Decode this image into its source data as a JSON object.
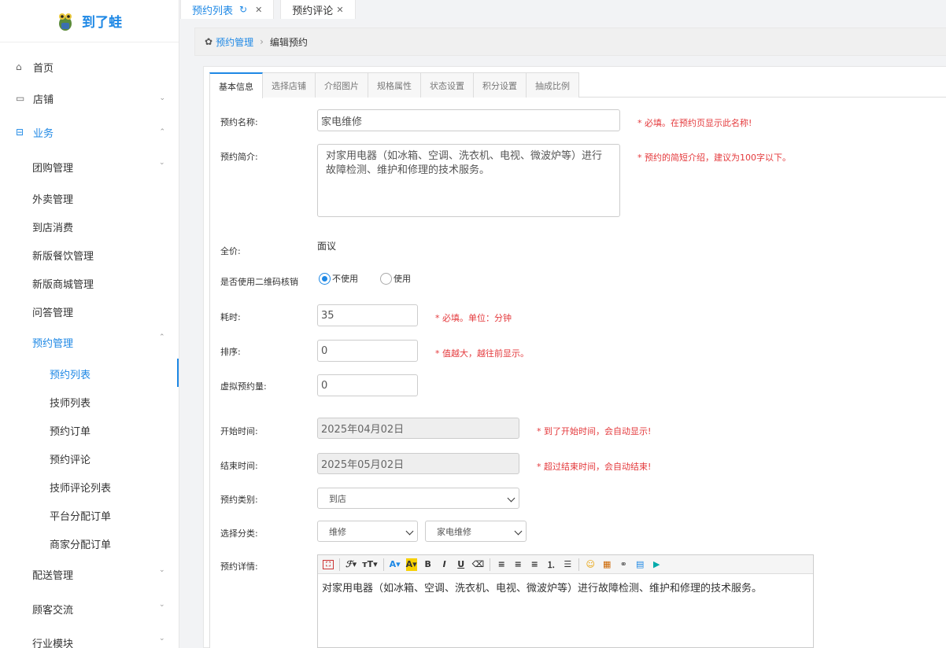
{
  "app": {
    "title": "到了蛙"
  },
  "sidebar": {
    "items": [
      {
        "label": "首页",
        "icon": "home-icon"
      },
      {
        "label": "店铺",
        "icon": "store-icon"
      },
      {
        "label": "业务",
        "icon": "business-icon"
      }
    ],
    "business_subs": [
      "团购管理",
      "外卖管理",
      "到店消费",
      "新版餐饮管理",
      "新版商城管理",
      "问答管理",
      "预约管理"
    ],
    "booking_subs": [
      "预约列表",
      "技师列表",
      "预约订单",
      "预约评论",
      "技师评论列表",
      "平台分配订单",
      "商家分配订单"
    ],
    "more": [
      "配送管理",
      "顾客交流",
      "行业模块"
    ]
  },
  "tabs": [
    {
      "label": "预约列表",
      "active": true
    },
    {
      "label": "预约评论",
      "active": false
    }
  ],
  "breadcrumb": {
    "root": "预约管理",
    "current": "编辑预约"
  },
  "form_tabs": [
    "基本信息",
    "选择店铺",
    "介绍图片",
    "规格属性",
    "状态设置",
    "积分设置",
    "抽成比例"
  ],
  "form": {
    "name": {
      "label": "预约名称:",
      "value": "家电维修",
      "hint": "* 必填。在预约页显示此名称!"
    },
    "intro": {
      "label": "预约简介:",
      "value": "对家用电器（如冰箱、空调、洗衣机、电视、微波炉等）进行故障检测、维护和修理的技术服务。",
      "hint": "* 预约的简短介绍，建议为100字以下。"
    },
    "price": {
      "label": "全价:",
      "value": "面议"
    },
    "qrcode": {
      "label": "是否使用二维码核销",
      "options": [
        "不使用",
        "使用"
      ],
      "selected": "不使用"
    },
    "duration": {
      "label": "耗时:",
      "value": "35",
      "hint": "* 必填。单位：分钟"
    },
    "sort": {
      "label": "排序:",
      "value": "0",
      "hint": "* 值越大，越往前显示。"
    },
    "virtual": {
      "label": "虚拟预约量:",
      "value": "0"
    },
    "start": {
      "label": "开始时间:",
      "value": "2025年04月02日",
      "hint": "* 到了开始时间，会自动显示!"
    },
    "end": {
      "label": "结束时间:",
      "value": "2025年05月02日",
      "hint": "* 超过结束时间，会自动结束!"
    },
    "type": {
      "label": "预约类别:",
      "value": "到店"
    },
    "category": {
      "label": "选择分类:",
      "value1": "维修",
      "value2": "家电维修"
    },
    "detail": {
      "label": "预约详情:",
      "value": "对家用电器（如冰箱、空调、洗衣机、电视、微波炉等）进行故障检测、维护和修理的技术服务。"
    }
  },
  "colors": {
    "accent": "#1e88e5",
    "hint": "#e4393c"
  }
}
